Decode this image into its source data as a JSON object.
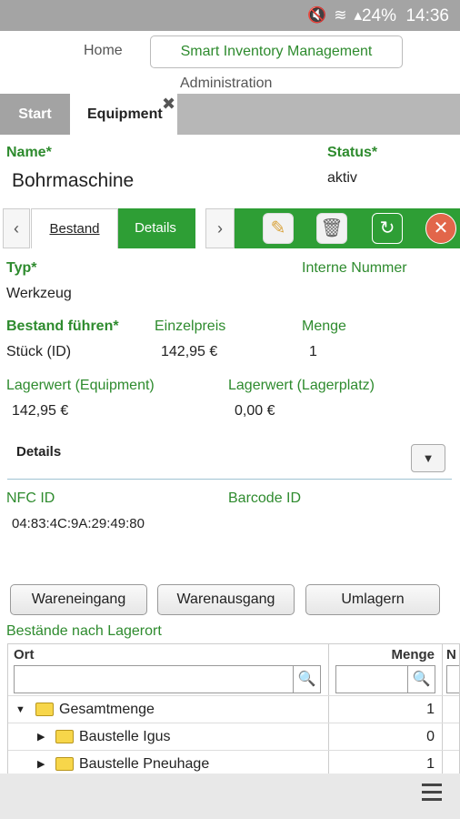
{
  "statusbar": {
    "battery": "24%",
    "clock": "14:36",
    "icons": [
      "mute-icon",
      "wifi-icon",
      "signal-icon"
    ]
  },
  "nav": {
    "home": "Home",
    "smart": "Smart Inventory Management",
    "admin": "Administration"
  },
  "tabs": {
    "start": "Start",
    "equipment": "Equipment",
    "close": "✖"
  },
  "record": {
    "name_label": "Name*",
    "name_value": "Bohrmaschine",
    "status_label": "Status*",
    "status_value": "aktiv"
  },
  "toolbar": {
    "prev": "‹",
    "next": "›",
    "bestand": "Bestand",
    "details": "Details"
  },
  "fields": {
    "typ_label": "Typ*",
    "typ_value": "Werkzeug",
    "interne_label": "Interne Nummer",
    "bestand_label": "Bestand führen*",
    "bestand_value": "Stück (ID)",
    "einzel_label": "Einzelpreis",
    "einzel_value": "142,95 €",
    "menge_label": "Menge",
    "menge_value": "1",
    "lwe_label": "Lagerwert (Equipment)",
    "lwe_value": "142,95 €",
    "lwl_label": "Lagerwert (Lagerplatz)",
    "lwl_value": "0,00 €",
    "details_label": "Details",
    "nfc_label": "NFC ID",
    "nfc_value": "04:83:4C:9A:29:49:80",
    "barcode_label": "Barcode ID"
  },
  "buttons": {
    "eingang": "Wareneingang",
    "ausgang": "Warenausgang",
    "umlagern": "Umlagern"
  },
  "grid": {
    "title": "Bestände nach Lagerort",
    "col_ort": "Ort",
    "col_menge": "Menge",
    "col_more": "N",
    "rows": [
      {
        "label": "Gesamtmenge",
        "value": "1"
      },
      {
        "label": "Baustelle Igus",
        "value": "0"
      },
      {
        "label": "Baustelle Pneuhage",
        "value": "1"
      }
    ]
  }
}
